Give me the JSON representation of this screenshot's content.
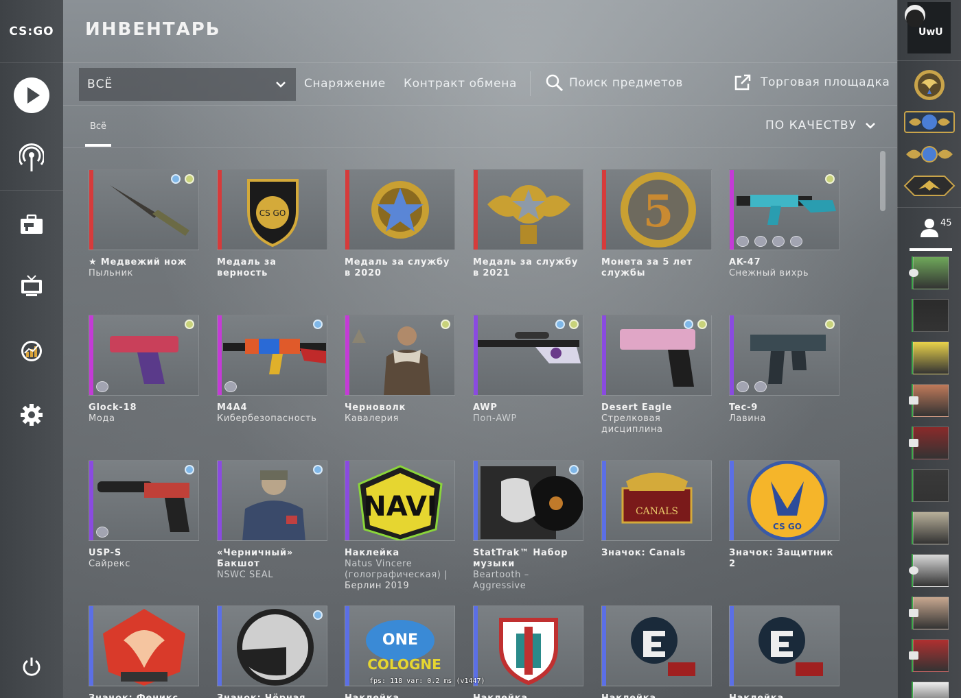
{
  "app": {
    "logo": "CS:GO",
    "title": "ИНВЕНТАРЬ"
  },
  "left_nav": {
    "items": [
      {
        "icon": "play-icon"
      },
      {
        "icon": "broadcast-icon"
      },
      {
        "icon": "briefcase-icon"
      },
      {
        "icon": "tv-icon"
      },
      {
        "icon": "stats-icon"
      },
      {
        "icon": "gear-icon"
      },
      {
        "icon": "power-icon"
      }
    ]
  },
  "toolbar": {
    "filter_value": "ВСЁ",
    "equipment": "Снаряжение",
    "trade_contract": "Контракт обмена",
    "search": "Поиск предметов",
    "market": "Торговая площадка"
  },
  "subtabs": {
    "all": "Всё",
    "sort": "ПО КАЧЕСТВУ"
  },
  "items": [
    {
      "name": "★ Медвежий нож",
      "sub": [
        "Пыльник"
      ],
      "rarity": "#d63b3b",
      "dots": [
        "#7fb7e8",
        "#c8d27a"
      ],
      "art": "knife"
    },
    {
      "name": "Медаль за верность",
      "sub": [],
      "rarity": "#d63b3b",
      "dots": [],
      "art": "medal-shield"
    },
    {
      "name": "Медаль за службу в 2020",
      "sub": [],
      "rarity": "#d63b3b",
      "dots": [],
      "art": "medal-star"
    },
    {
      "name": "Медаль за службу в 2021",
      "sub": [],
      "rarity": "#d63b3b",
      "dots": [],
      "art": "medal-wings"
    },
    {
      "name": "Монета за 5 лет службы",
      "sub": [],
      "rarity": "#d63b3b",
      "dots": [],
      "art": "coin-5"
    },
    {
      "name": "AK-47",
      "sub": [
        "Снежный вихрь"
      ],
      "rarity": "#c43bd6",
      "dots": [
        "#c8d27a"
      ],
      "art": "rifle-blue",
      "stickers": 4
    },
    {
      "name": "Glock-18",
      "sub": [
        "Мода"
      ],
      "rarity": "#c43bd6",
      "dots": [
        "#c8d27a"
      ],
      "art": "pistol-pink",
      "stickers": 1
    },
    {
      "name": "M4A4",
      "sub": [
        "Кибербезопасность"
      ],
      "rarity": "#c43bd6",
      "dots": [
        "#7fb7e8"
      ],
      "art": "rifle-color",
      "stickers": 1
    },
    {
      "name": "Черноволк",
      "sub": [
        "Кавалерия"
      ],
      "rarity": "#c43bd6",
      "dots": [
        "#c8d27a"
      ],
      "art": "agent"
    },
    {
      "name": "AWP",
      "sub": [
        "Поп-AWP"
      ],
      "rarity": "#8a4be0",
      "dots": [
        "#7fb7e8",
        "#c8d27a"
      ],
      "art": "sniper"
    },
    {
      "name": "Desert Eagle",
      "sub": [
        "Стрелковая",
        "дисциплина"
      ],
      "rarity": "#8a4be0",
      "dots": [
        "#7fb7e8",
        "#c8d27a"
      ],
      "art": "deagle"
    },
    {
      "name": "Tec-9",
      "sub": [
        "Лавина"
      ],
      "rarity": "#8a4be0",
      "dots": [
        "#c8d27a"
      ],
      "art": "tec9",
      "stickers": 2
    },
    {
      "name": "USP-S",
      "sub": [
        "Сайрекс"
      ],
      "rarity": "#8a4be0",
      "dots": [
        "#7fb7e8"
      ],
      "art": "usp",
      "stickers": 1
    },
    {
      "name": "«Черничный» Бакшот",
      "sub": [
        "NSWC SEAL"
      ],
      "rarity": "#8a4be0",
      "dots": [
        "#7fb7e8"
      ],
      "art": "agent2"
    },
    {
      "name": "Наклейка",
      "sub": [
        "Natus Vincere",
        "(голографическая) |",
        "Берлин 2019"
      ],
      "rarity": "#8a4be0",
      "dots": [],
      "art": "navi"
    },
    {
      "name": "StatTrak™ Набор музыки",
      "sub": [
        "Beartooth –",
        "Aggressive"
      ],
      "rarity": "#5b6fe6",
      "dots": [
        "#7fb7e8"
      ],
      "art": "music"
    },
    {
      "name": "Значок: Canals",
      "sub": [],
      "rarity": "#5b6fe6",
      "dots": [],
      "art": "canals"
    },
    {
      "name": "Значок: Защитник 2",
      "sub": [],
      "rarity": "#5b6fe6",
      "dots": [],
      "art": "defender"
    },
    {
      "name": "Значок: Феникс",
      "sub": [],
      "rarity": "#5b6fe6",
      "dots": [],
      "art": "phoenix"
    },
    {
      "name": "Значок: Чёрная Меза",
      "sub": [],
      "rarity": "#5b6fe6",
      "dots": [
        "#7fb7e8"
      ],
      "art": "mesa"
    },
    {
      "name": "Наклейка",
      "sub": [],
      "rarity": "#5b6fe6",
      "dots": [],
      "art": "esl"
    },
    {
      "name": "Наклейка",
      "sub": [],
      "rarity": "#5b6fe6",
      "dots": [],
      "art": "shield-team"
    },
    {
      "name": "Наклейка",
      "sub": [],
      "rarity": "#5b6fe6",
      "dots": [],
      "art": "eg"
    },
    {
      "name": "Наклейка",
      "sub": [],
      "rarity": "#5b6fe6",
      "dots": [],
      "art": "eg"
    }
  ],
  "right_nav": {
    "profile_name": "UwU",
    "friends_count": "45"
  },
  "fps_overlay": "fps:   118 var:  0.2 ms (v1447)"
}
